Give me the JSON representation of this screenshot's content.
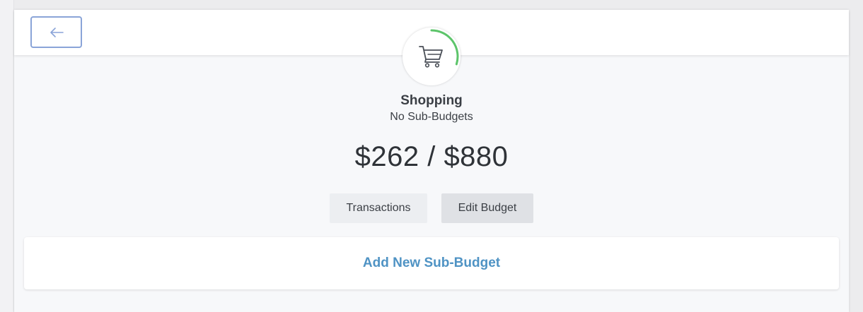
{
  "header": {
    "back_icon": "arrow-left-icon"
  },
  "category": {
    "icon": "shopping-cart-icon",
    "name": "Shopping",
    "sub_budget_status": "No Sub-Budgets",
    "spent": "$262",
    "separator": "/",
    "budget": "$880",
    "progress_fraction": 0.2977,
    "progress_color": "#5cc46a",
    "track_color": "#eceef1"
  },
  "actions": {
    "transactions_label": "Transactions",
    "edit_budget_label": "Edit Budget"
  },
  "sub_budgets": {
    "add_label": "Add New Sub-Budget",
    "link_color": "#4f93c4"
  }
}
